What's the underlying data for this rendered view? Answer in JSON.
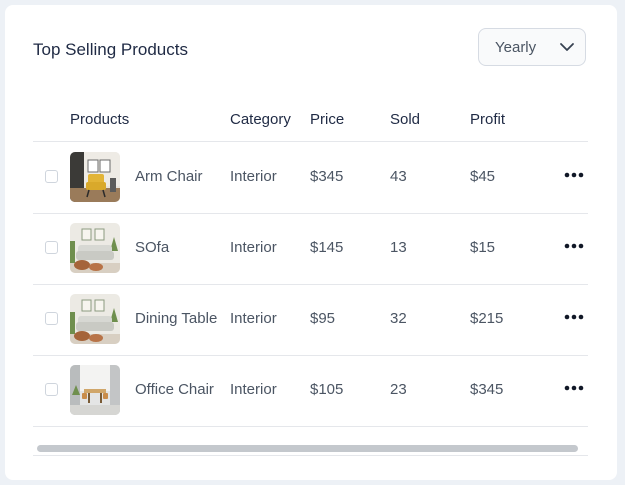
{
  "card": {
    "title": "Top Selling Products",
    "period": {
      "selected": "Yearly"
    }
  },
  "table": {
    "headers": {
      "products": "Products",
      "category": "Category",
      "price": "Price",
      "sold": "Sold",
      "profit": "Profit"
    },
    "rows": [
      {
        "name": "Arm Chair",
        "category": "Interior",
        "price": "$345",
        "sold": "43",
        "profit": "$45",
        "thumbnail_icon": "arm-chair-photo"
      },
      {
        "name": "SOfa",
        "category": "Interior",
        "price": "$145",
        "sold": "13",
        "profit": "$15",
        "thumbnail_icon": "sofa-photo"
      },
      {
        "name": "Dining Table",
        "category": "Interior",
        "price": "$95",
        "sold": "32",
        "profit": "$215",
        "thumbnail_icon": "sofa-photo"
      },
      {
        "name": "Office Chair",
        "category": "Interior",
        "price": "$105",
        "sold": "23",
        "profit": "$345",
        "thumbnail_icon": "office-photo"
      }
    ]
  },
  "colors": {
    "page_background": "#edf1f6",
    "card_background": "#ffffff",
    "title_text": "#1f2a44",
    "body_text": "#4b5563",
    "border": "#e5e7eb",
    "scrollbar": "#c4c8cd"
  }
}
